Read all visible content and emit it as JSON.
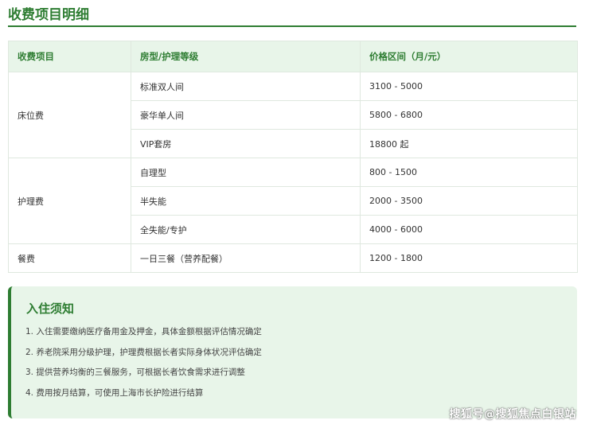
{
  "page_title": "收费项目明细",
  "table": {
    "headers": [
      "收费项目",
      "房型/护理等级",
      "价格区间（月/元）"
    ],
    "groups": [
      {
        "category": "床位费",
        "rows": [
          {
            "item": "标准双人间",
            "price": "3100 - 5000"
          },
          {
            "item": "豪华单人间",
            "price": "5800 - 6800"
          },
          {
            "item": "VIP套房",
            "price": "18800 起"
          }
        ]
      },
      {
        "category": "护理费",
        "rows": [
          {
            "item": "自理型",
            "price": "800 - 1500"
          },
          {
            "item": "半失能",
            "price": "2000 - 3500"
          },
          {
            "item": "全失能/专护",
            "price": "4000 - 6000"
          }
        ]
      },
      {
        "category": "餐费",
        "rows": [
          {
            "item": "一日三餐（营养配餐）",
            "price": "1200 - 1800"
          }
        ]
      }
    ]
  },
  "notice": {
    "title": "入住须知",
    "items": [
      "1. 入住需要缴纳医疗备用金及押金，具体金额根据评估情况确定",
      "2. 养老院采用分级护理，护理费根据长者实际身体状况评估确定",
      "3. 提供营养均衡的三餐服务，可根据长者饮食需求进行调整",
      "4. 费用按月结算，可使用上海市长护险进行结算"
    ]
  },
  "watermark": "搜狐号@搜狐焦点白银站",
  "colors": {
    "accent": "#2e7d32",
    "header_bg": "#e8f5e9",
    "border": "#dfe8df"
  }
}
